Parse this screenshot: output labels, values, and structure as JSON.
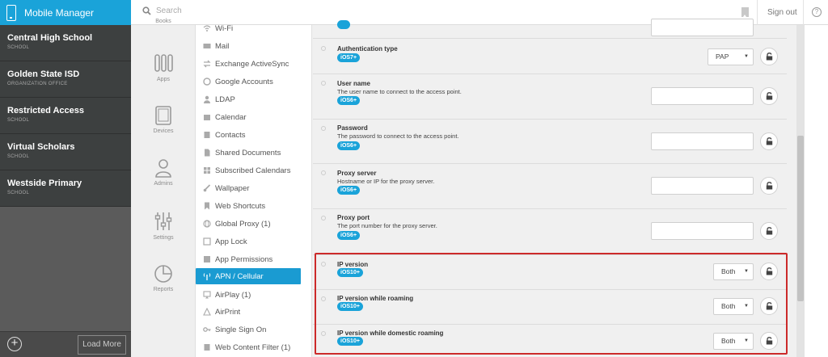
{
  "app": {
    "title": "Mobile Manager"
  },
  "header": {
    "search_placeholder": "Search",
    "sign_out": "Sign out",
    "help": "?"
  },
  "organizations": [
    {
      "name": "Central High School",
      "type": "SCHOOL"
    },
    {
      "name": "Golden State ISD",
      "type": "ORGANIZATION OFFICE"
    },
    {
      "name": "Restricted Access",
      "type": "SCHOOL"
    },
    {
      "name": "Virtual Scholars",
      "type": "SCHOOL"
    },
    {
      "name": "Westside Primary",
      "type": "SCHOOL"
    }
  ],
  "org_footer": {
    "add": "+",
    "load_more": "Load More"
  },
  "nav": {
    "books": "Books",
    "apps": "Apps",
    "devices": "Devices",
    "admins": "Admins",
    "settings": "Settings",
    "reports": "Reports"
  },
  "payloads": [
    "Wi-Fi",
    "Mail",
    "Exchange ActiveSync",
    "Google Accounts",
    "LDAP",
    "Calendar",
    "Contacts",
    "Shared Documents",
    "Subscribed Calendars",
    "Wallpaper",
    "Web Shortcuts",
    "Global Proxy (1)",
    "App Lock",
    "App Permissions",
    "APN / Cellular",
    "AirPlay (1)",
    "AirPrint",
    "Single Sign On",
    "Web Content Filter (1)"
  ],
  "active_payload": "APN / Cellular",
  "settings": [
    {
      "title": "Authentication type",
      "description": "",
      "badge": "iOS7+",
      "control": "select",
      "value": "PAP"
    },
    {
      "title": "User name",
      "description": "The user name to connect to the access point.",
      "badge": "iOS6+",
      "control": "text",
      "value": ""
    },
    {
      "title": "Password",
      "description": "The password to connect to the access point.",
      "badge": "iOS6+",
      "control": "text",
      "value": ""
    },
    {
      "title": "Proxy server",
      "description": "Hostname or IP for the proxy server.",
      "badge": "iOS6+",
      "control": "text",
      "value": ""
    },
    {
      "title": "Proxy port",
      "description": "The port number for the proxy server.",
      "badge": "iOS6+",
      "control": "text",
      "value": ""
    },
    {
      "title": "IP version",
      "description": "",
      "badge": "iOS10+",
      "control": "select",
      "value": "Both"
    },
    {
      "title": "IP version while roaming",
      "description": "",
      "badge": "iOS10+",
      "control": "select",
      "value": "Both"
    },
    {
      "title": "IP version while domestic roaming",
      "description": "",
      "badge": "iOS10+",
      "control": "select",
      "value": "Both"
    }
  ],
  "colors": {
    "brand": "#1aa3d9",
    "highlight": "#cc2a2a",
    "sidebar": "#3d4040"
  }
}
